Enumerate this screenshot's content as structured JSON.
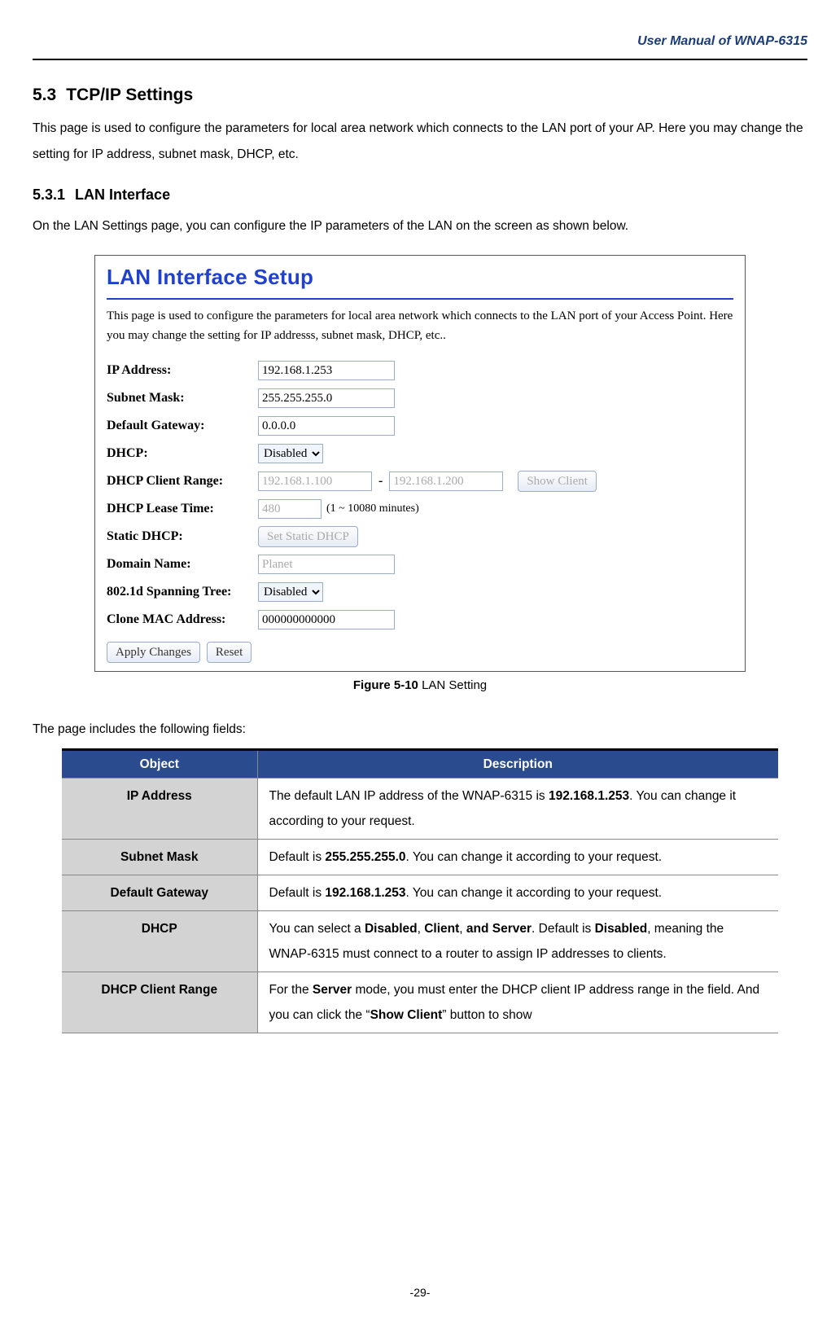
{
  "header": {
    "manual_title": "User Manual of WNAP-6315"
  },
  "section": {
    "num": "5.3",
    "title": "TCP/IP Settings",
    "intro": "This page is used to configure the parameters for local area network which connects to the LAN port of your AP. Here you may change the setting for IP address, subnet mask, DHCP, etc."
  },
  "subsection": {
    "num": "5.3.1",
    "title": "LAN Interface",
    "intro": "On the LAN Settings page, you can configure the IP parameters of the LAN on the screen as shown below."
  },
  "panel": {
    "title": "LAN Interface Setup",
    "desc": "This page is used to configure the parameters for local area network which connects to the LAN port of your Access Point. Here you may change the setting for IP addresss, subnet mask, DHCP, etc..",
    "labels": {
      "ip": "IP Address:",
      "subnet": "Subnet Mask:",
      "gateway": "Default Gateway:",
      "dhcp": "DHCP:",
      "range": "DHCP Client Range:",
      "lease": "DHCP Lease Time:",
      "static": "Static DHCP:",
      "domain": "Domain Name:",
      "spanning": "802.1d Spanning Tree:",
      "clone": "Clone MAC Address:"
    },
    "values": {
      "ip": "192.168.1.253",
      "subnet": "255.255.255.0",
      "gateway": "0.0.0.0",
      "dhcp_selected": "Disabled",
      "range_start": "192.168.1.100",
      "range_end": "192.168.1.200",
      "show_client": "Show Client",
      "lease": "480",
      "lease_hint": "(1 ~ 10080 minutes)",
      "static_btn": "Set Static DHCP",
      "domain": "Planet",
      "spanning_selected": "Disabled",
      "clone": "000000000000"
    },
    "buttons": {
      "apply": "Apply Changes",
      "reset": "Reset"
    }
  },
  "figure": {
    "label": "Figure 5-10",
    "caption": "LAN Setting"
  },
  "pretable": "The page includes the following fields:",
  "table": {
    "headers": {
      "object": "Object",
      "desc": "Description"
    },
    "rows": [
      {
        "object": "IP Address",
        "desc_parts": [
          "The default LAN IP address of the WNAP-6315 is ",
          "192.168.1.253",
          ". You can change it according to your request."
        ]
      },
      {
        "object": "Subnet Mask",
        "desc_parts": [
          "Default is ",
          "255.255.255.0",
          ". You can change it according to your request."
        ]
      },
      {
        "object": "Default Gateway",
        "desc_parts": [
          "Default is ",
          "192.168.1.253",
          ". You can change it according to your request."
        ]
      },
      {
        "object": "DHCP",
        "desc_parts": [
          "You can select a ",
          "Disabled",
          ", ",
          "Client",
          ", ",
          "and Server",
          ". Default is ",
          "Disabled",
          ", meaning the WNAP-6315 must connect to a router to assign IP addresses to clients."
        ]
      },
      {
        "object": "DHCP Client Range",
        "desc_parts": [
          "For the ",
          "Server",
          " mode, you must enter the DHCP client IP address range in the field. And you can click the “",
          "Show Client",
          "” button to show"
        ]
      }
    ]
  },
  "page_num": "-29-"
}
